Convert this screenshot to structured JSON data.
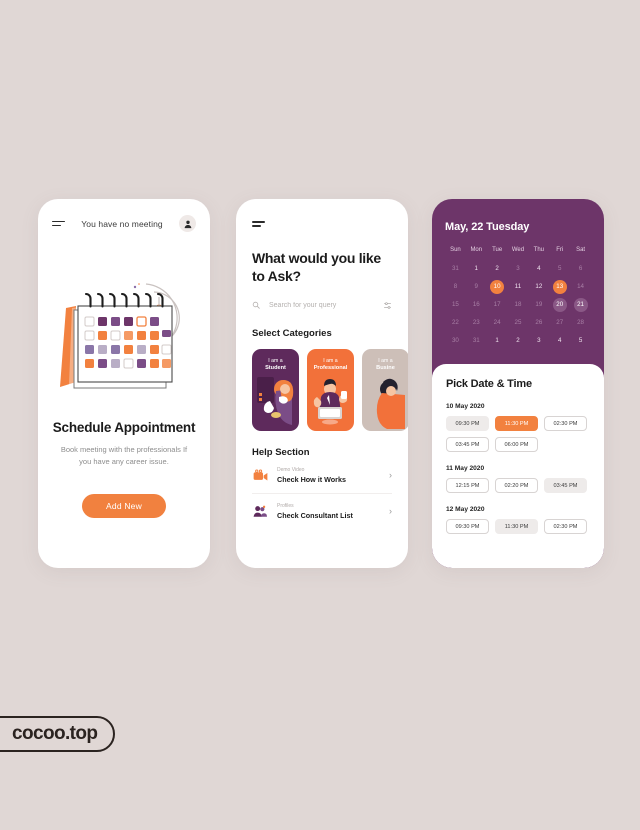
{
  "page": {
    "background_color": "#e0d7d5",
    "accent_orange": "#f2813f",
    "accent_purple": "#6d3569"
  },
  "logo": {
    "text": "cocoo.top"
  },
  "screen1": {
    "menu_icon": "hamburger-icon",
    "header_title": "You have no meeting",
    "avatar_icon": "user-avatar-icon",
    "illustration": "desk-calendar-illustration",
    "headline": "Schedule Appointment",
    "subtext": "Book meeting with the professionals If you have any career issue.",
    "cta_label": "Add New"
  },
  "screen2": {
    "menu_icon": "hamburger-icon",
    "headline": "What would you like to Ask?",
    "search": {
      "icon": "search-icon",
      "placeholder": "Search for your query",
      "value": "",
      "filter_icon": "filter-sliders-icon"
    },
    "categories_title": "Select Categories",
    "categories": [
      {
        "prefix": "I am a",
        "name": "Student",
        "color": "#5e2a5c"
      },
      {
        "prefix": "I am a",
        "name": "Professional",
        "color": "#f2713a"
      },
      {
        "prefix": "I am a",
        "name": "Busine",
        "color": "#cdbfb8"
      }
    ],
    "help_title": "Help Section",
    "help_items": [
      {
        "kicker": "Demo Video",
        "title": "Check How it Works",
        "icon": "video-camera-icon",
        "chevron": "chevron-right-icon"
      },
      {
        "kicker": "Profiles",
        "title": "Check Consultant List",
        "icon": "people-group-icon",
        "chevron": "chevron-right-icon"
      }
    ]
  },
  "screen3": {
    "month_title": "May, 22 Tuesday",
    "day_names": [
      "Sun",
      "Mon",
      "Tue",
      "Wed",
      "Thu",
      "Fri",
      "Sat"
    ],
    "weeks": [
      [
        {
          "d": "31",
          "state": "muted"
        },
        {
          "d": "1",
          "state": "normal"
        },
        {
          "d": "2",
          "state": "normal"
        },
        {
          "d": "3",
          "state": "muted"
        },
        {
          "d": "4",
          "state": "normal"
        },
        {
          "d": "5",
          "state": "muted"
        },
        {
          "d": "6",
          "state": "muted"
        }
      ],
      [
        {
          "d": "8",
          "state": "muted"
        },
        {
          "d": "9",
          "state": "muted"
        },
        {
          "d": "10",
          "state": "sel"
        },
        {
          "d": "11",
          "state": "normal"
        },
        {
          "d": "12",
          "state": "normal"
        },
        {
          "d": "13",
          "state": "sel"
        },
        {
          "d": "14",
          "state": "muted"
        }
      ],
      [
        {
          "d": "15",
          "state": "muted"
        },
        {
          "d": "16",
          "state": "muted"
        },
        {
          "d": "17",
          "state": "muted"
        },
        {
          "d": "18",
          "state": "muted"
        },
        {
          "d": "19",
          "state": "muted"
        },
        {
          "d": "20",
          "state": "soft"
        },
        {
          "d": "21",
          "state": "soft"
        }
      ],
      [
        {
          "d": "22",
          "state": "muted"
        },
        {
          "d": "23",
          "state": "muted"
        },
        {
          "d": "24",
          "state": "muted"
        },
        {
          "d": "25",
          "state": "muted"
        },
        {
          "d": "26",
          "state": "muted"
        },
        {
          "d": "27",
          "state": "muted"
        },
        {
          "d": "28",
          "state": "muted"
        }
      ],
      [
        {
          "d": "30",
          "state": "muted"
        },
        {
          "d": "31",
          "state": "muted"
        },
        {
          "d": "1",
          "state": "normal"
        },
        {
          "d": "2",
          "state": "normal"
        },
        {
          "d": "3",
          "state": "normal"
        },
        {
          "d": "4",
          "state": "normal"
        },
        {
          "d": "5",
          "state": "normal"
        }
      ]
    ],
    "picker_title": "Pick Date & Time",
    "date_groups": [
      {
        "date": "10 May 2020",
        "slots": [
          {
            "time": "09:30 PM",
            "state": "grey"
          },
          {
            "time": "11:30 PM",
            "state": "active"
          },
          {
            "time": "02:30 PM",
            "state": "normal"
          },
          {
            "time": "03:45 PM",
            "state": "normal"
          },
          {
            "time": "06:00 PM",
            "state": "normal"
          }
        ]
      },
      {
        "date": "11 May 2020",
        "slots": [
          {
            "time": "12:15 PM",
            "state": "normal"
          },
          {
            "time": "02:20 PM",
            "state": "normal"
          },
          {
            "time": "03:45 PM",
            "state": "grey"
          }
        ]
      },
      {
        "date": "12 May 2020",
        "slots": [
          {
            "time": "09:30 PM",
            "state": "normal"
          },
          {
            "time": "11:30 PM",
            "state": "grey"
          },
          {
            "time": "02:30 PM",
            "state": "normal"
          }
        ]
      }
    ]
  }
}
